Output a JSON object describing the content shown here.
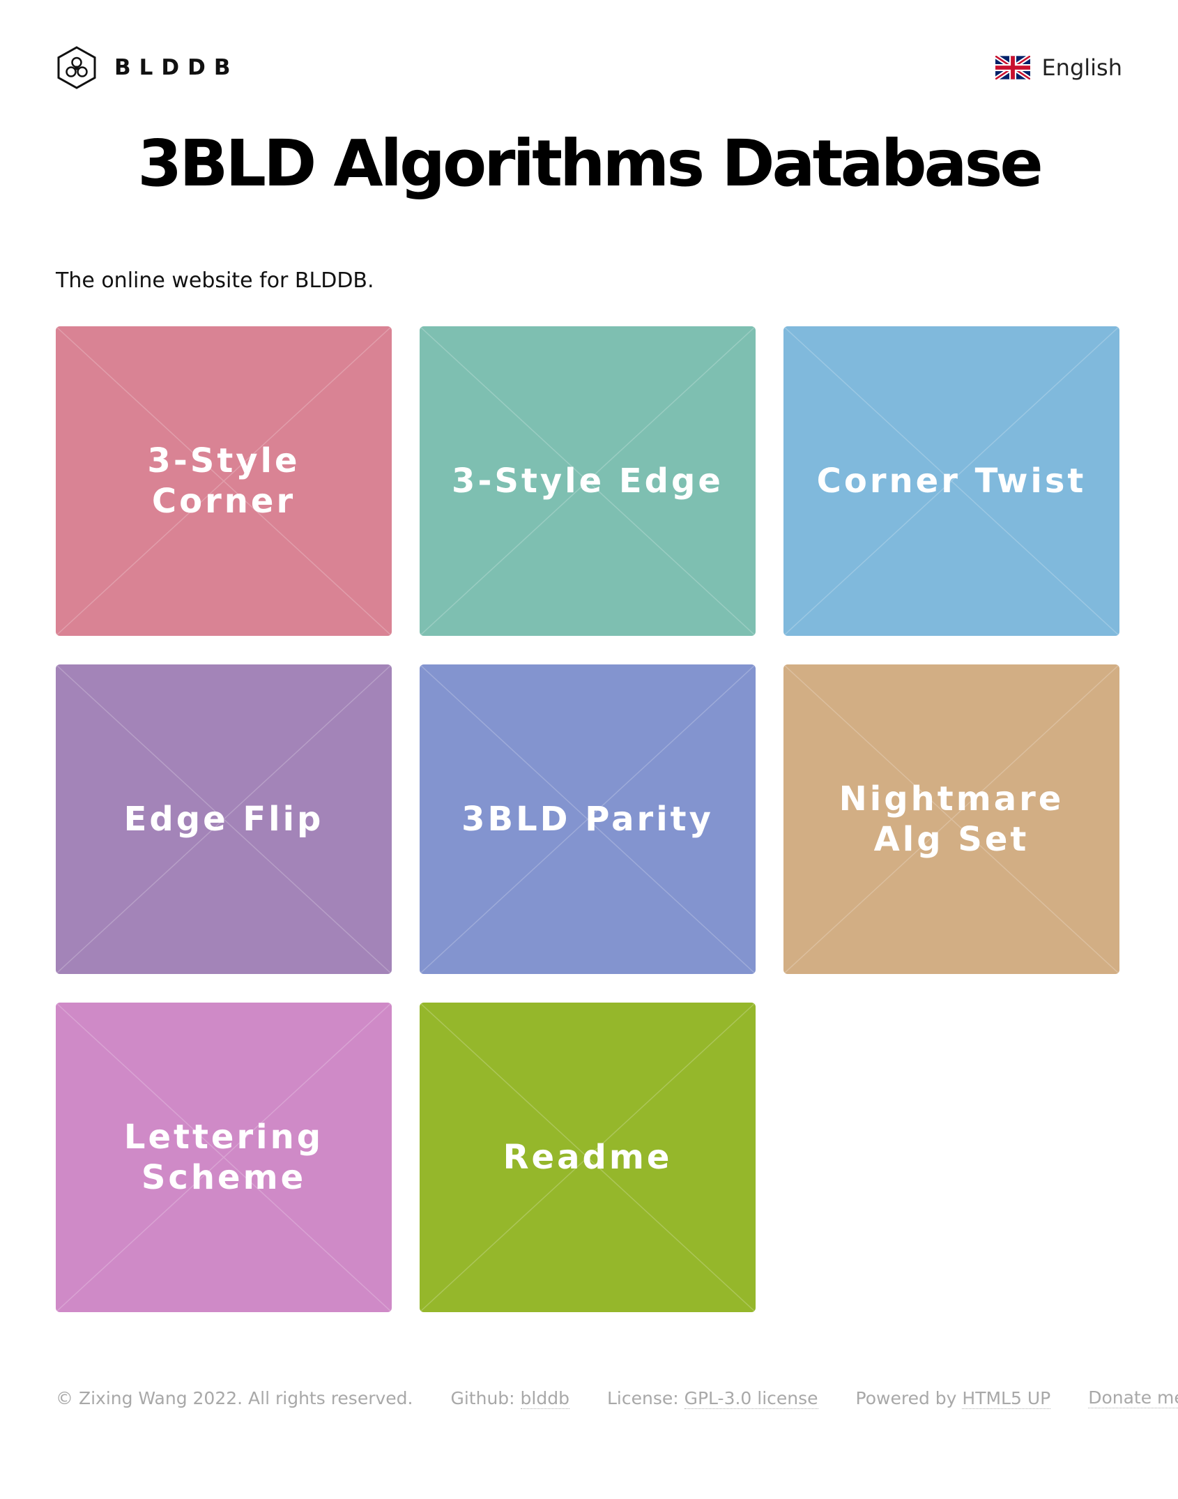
{
  "header": {
    "brand_name": "BLDDB",
    "language": "English"
  },
  "page_title": "3BLD Algorithms Database",
  "intro": "The online website for BLDDB.",
  "tiles": [
    {
      "label": "3-Style Corner",
      "color": "#d98394"
    },
    {
      "label": "3-Style Edge",
      "color": "#7ebfb1"
    },
    {
      "label": "Corner Twist",
      "color": "#80b9dc"
    },
    {
      "label": "Edge Flip",
      "color": "#a384b8"
    },
    {
      "label": "3BLD Parity",
      "color": "#8394cf"
    },
    {
      "label": "Nightmare Alg Set",
      "color": "#d2ae84"
    },
    {
      "label": "Lettering Scheme",
      "color": "#cf8ac7"
    },
    {
      "label": "Readme",
      "color": "#95b72b"
    }
  ],
  "footer": {
    "copyright": "© Zixing Wang 2022. All rights reserved.",
    "github_prefix": "Github: ",
    "github_link": "blddb",
    "license_prefix": "License: ",
    "license_link": "GPL-3.0 license",
    "powered_prefix": "Powered by ",
    "powered_link": "HTML5 UP",
    "donate_link": "Donate me"
  }
}
